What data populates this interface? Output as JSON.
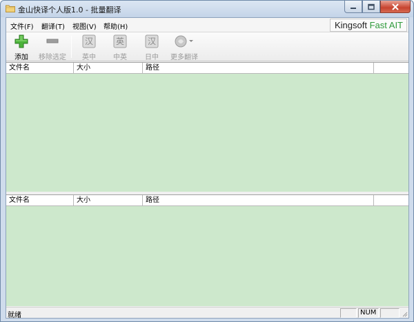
{
  "window": {
    "title": "金山快译个人版1.0 - 批量翻译"
  },
  "menu": {
    "items": [
      {
        "label": "文件(F)"
      },
      {
        "label": "翻译(T)"
      },
      {
        "label": "视图(V)"
      },
      {
        "label": "帮助(H)"
      }
    ]
  },
  "brand": {
    "part1": "Kingsoft ",
    "part2": "Fast AIT",
    "accent_color": "#2e9a3a"
  },
  "toolbar": {
    "add_label": "添加",
    "remove_label": "移除选定",
    "en_zh_label": "英中",
    "zh_en_label": "中英",
    "ja_zh_label": "日中",
    "more_label": "更多翻译"
  },
  "top_table": {
    "columns": [
      "文件名",
      "大小",
      "路径"
    ]
  },
  "bottom_table": {
    "columns": [
      "文件名",
      "大小",
      "路径"
    ]
  },
  "statusbar": {
    "text": "就绪",
    "num": "NUM"
  },
  "colors": {
    "pane_bg": "#cde8cc"
  }
}
